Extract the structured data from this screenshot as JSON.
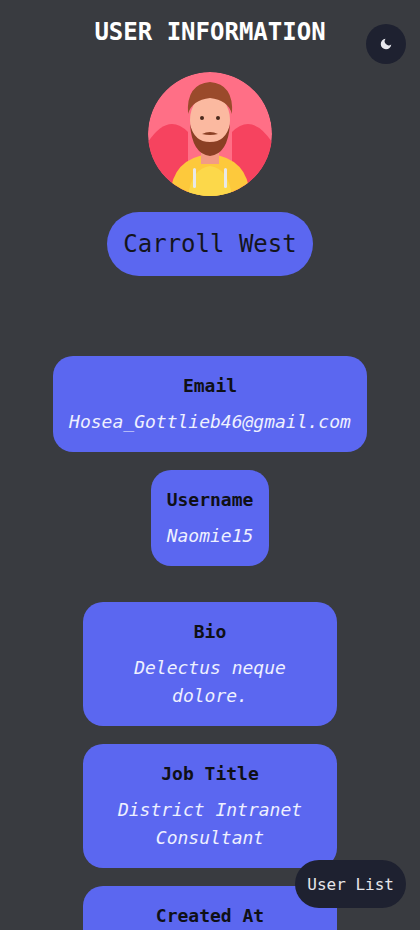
{
  "page": {
    "title": "USER INFORMATION"
  },
  "user": {
    "name": "Carroll West"
  },
  "sections": [
    {
      "fields": [
        {
          "label": "Email",
          "value": "Hosea_Gottlieb46@gmail.com",
          "width": "wide"
        },
        {
          "label": "Username",
          "value": "Naomie15",
          "width": "fit"
        }
      ]
    },
    {
      "fields": [
        {
          "label": "Bio",
          "value": "Delectus neque dolore.",
          "width": "narrow"
        },
        {
          "label": "Job Title",
          "value": "District Intranet Consultant",
          "width": "narrow"
        },
        {
          "label": "Created At",
          "value": "",
          "width": "narrow"
        }
      ]
    }
  ],
  "buttons": [
    "User List"
  ]
}
